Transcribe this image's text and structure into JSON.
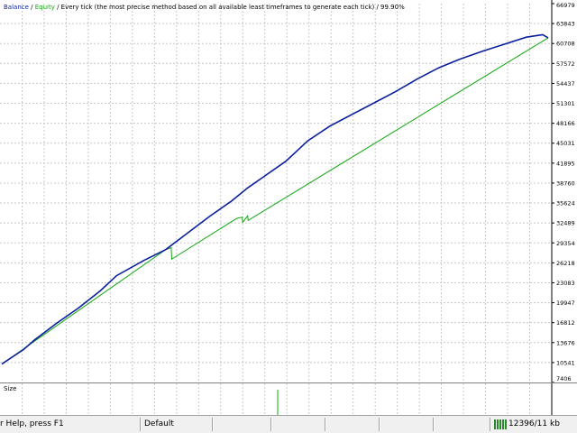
{
  "legend": {
    "balance": "Balance",
    "sep1": " / ",
    "equity": "Equity",
    "desc": " / Every tick (the most precise method based on all available least timeframes to generate each tick)",
    "quality": " / 99.90%"
  },
  "colors": {
    "balance": "#0a1f9e",
    "equity": "#13a713",
    "grid": "#c8c8c8",
    "axis": "#000000",
    "size_bar": "#13a713"
  },
  "size_panel": {
    "label": "Size"
  },
  "status_bar": {
    "help": "r Help, press F1",
    "profile": "Default",
    "connection": "12396/11 kb",
    "connection_icon": "signal-bars-icon"
  },
  "chart_data": {
    "type": "line",
    "title": "",
    "xlabel": "",
    "ylabel": "",
    "ylim": [
      7406,
      66979
    ],
    "y_ticks": [
      66979,
      63843,
      60708,
      57572,
      54437,
      51301,
      48166,
      45031,
      41895,
      38760,
      35624,
      32489,
      29354,
      26218,
      23083,
      19947,
      16812,
      13676,
      10541,
      7406
    ],
    "xlim": [
      0,
      1000
    ],
    "grid": true,
    "series": [
      {
        "name": "Balance",
        "color": "#0a1f9e",
        "x": [
          0,
          40,
          60,
          100,
          140,
          180,
          210,
          260,
          300,
          340,
          380,
          420,
          450,
          480,
          520,
          560,
          600,
          640,
          680,
          720,
          760,
          800,
          840,
          880,
          920,
          960,
          990,
          1000
        ],
        "y": [
          10300,
          12600,
          14100,
          16700,
          19100,
          21800,
          24200,
          26600,
          28300,
          30900,
          33500,
          35900,
          38000,
          39800,
          42200,
          45400,
          47700,
          49500,
          51300,
          53100,
          55100,
          56900,
          58300,
          59500,
          60600,
          61700,
          62100,
          61600
        ]
      },
      {
        "name": "Equity",
        "color": "#13a713",
        "x": [
          0,
          300,
          310,
          311,
          430,
          440,
          441,
          450,
          451,
          1000
        ],
        "y": [
          10300,
          28300,
          28600,
          26800,
          33200,
          33400,
          32600,
          33600,
          32900,
          61600
        ]
      }
    ],
    "size_bars": [
      {
        "x": 505,
        "value": 1
      }
    ]
  }
}
